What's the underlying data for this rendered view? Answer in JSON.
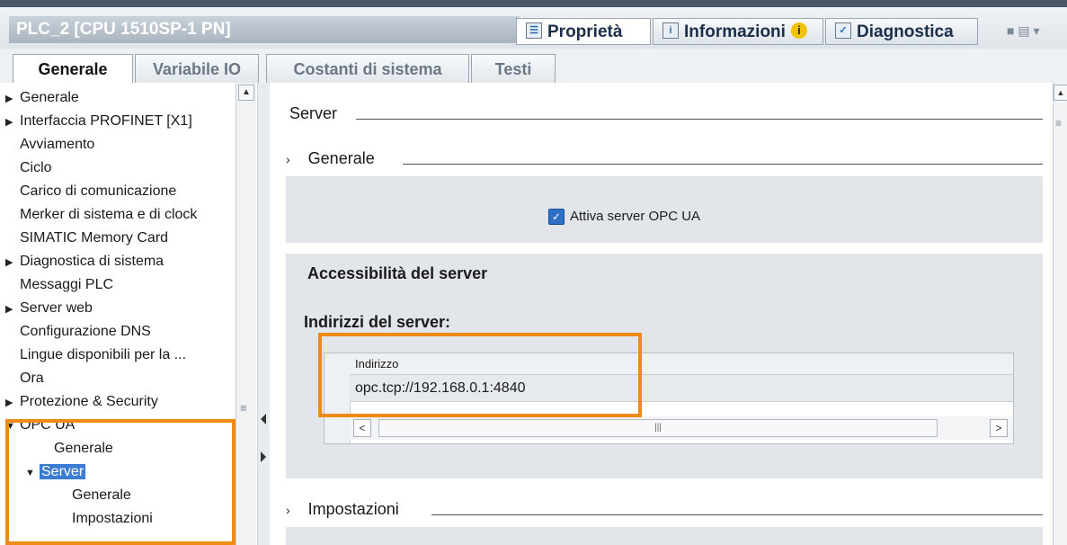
{
  "header": {
    "device_title": "PLC_2 [CPU 1510SP-1 PN]",
    "tabs": [
      {
        "label": "Proprietà",
        "icon": "properties-icon"
      },
      {
        "label": "Informazioni",
        "icon": "info-icon"
      },
      {
        "label": "Diagnostica",
        "icon": "diagnostics-icon"
      }
    ],
    "info_badge": "i"
  },
  "tabs": [
    "Generale",
    "Variabile IO",
    "Costanti di sistema",
    "Testi"
  ],
  "nav": {
    "items": [
      {
        "label": "Generale",
        "arrow": "▶"
      },
      {
        "label": "Interfaccia PROFINET [X1]",
        "arrow": "▶"
      },
      {
        "label": "Avviamento",
        "arrow": ""
      },
      {
        "label": "Ciclo",
        "arrow": ""
      },
      {
        "label": "Carico di comunicazione",
        "arrow": ""
      },
      {
        "label": "Merker di sistema e di clock",
        "arrow": ""
      },
      {
        "label": "SIMATIC Memory Card",
        "arrow": ""
      },
      {
        "label": "Diagnostica di sistema",
        "arrow": "▶"
      },
      {
        "label": "Messaggi PLC",
        "arrow": ""
      },
      {
        "label": "Server web",
        "arrow": "▶"
      },
      {
        "label": "Configurazione DNS",
        "arrow": ""
      },
      {
        "label": "Lingue disponibili per la ...",
        "arrow": ""
      },
      {
        "label": "Ora",
        "arrow": ""
      },
      {
        "label": "Protezione & Security",
        "arrow": "▶"
      },
      {
        "label": "OPC UA",
        "arrow": "▼"
      },
      {
        "label": "Generale",
        "arrow": ""
      },
      {
        "label": "Server",
        "arrow": "▼"
      },
      {
        "label": "Generale",
        "arrow": ""
      },
      {
        "label": "Impostazioni",
        "arrow": ""
      }
    ]
  },
  "content": {
    "section_server": "Server",
    "section_generale": "Generale",
    "checkbox_label": "Attiva server OPC UA",
    "checkbox_checked": true,
    "accessibility_title": "Accessibilità del server",
    "addresses_title": "Indirizzi del server:",
    "table": {
      "column_header": "Indirizzo",
      "rows": [
        "opc.tcp://192.168.0.1:4840"
      ]
    },
    "section_impostazioni": "Impostazioni"
  },
  "colors": {
    "highlight": "#f08a16",
    "selection": "#3a7bd5",
    "checkbox": "#2e6fc7"
  }
}
